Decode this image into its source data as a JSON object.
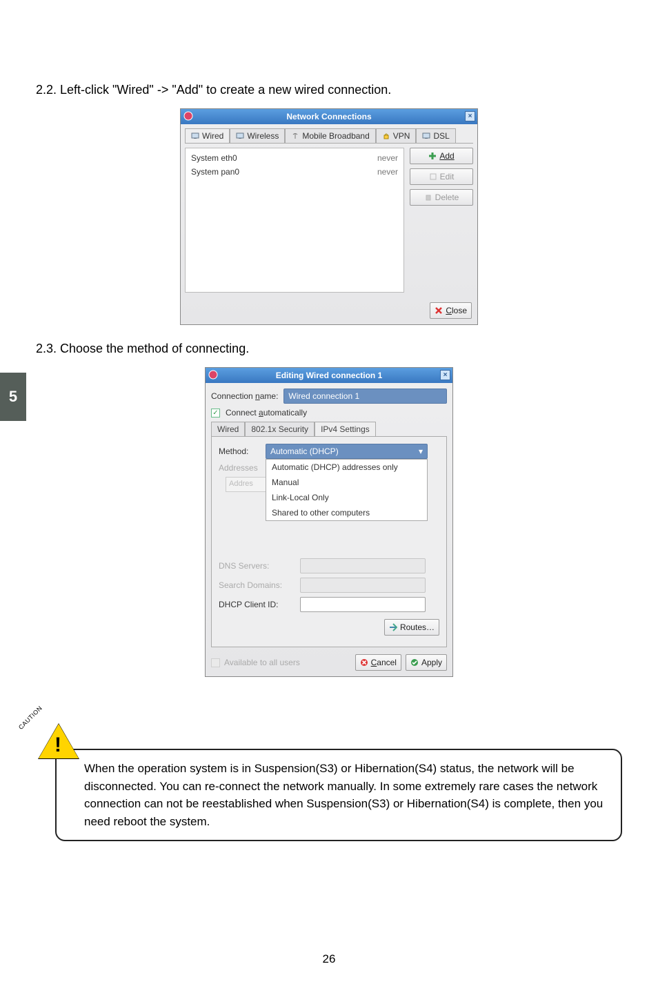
{
  "page_number": "26",
  "page_tab": "5",
  "step22": "2.2. Left-click \"Wired\" -> \"Add\" to create a new wired connection.",
  "step23": "2.3. Choose the method of connecting.",
  "dialog1": {
    "title": "Network Connections",
    "tabs": {
      "wired": "Wired",
      "wireless": "Wireless",
      "mobile": "Mobile Broadband",
      "vpn": "VPN",
      "dsl": "DSL"
    },
    "connections": [
      {
        "name": "System eth0",
        "last": "never"
      },
      {
        "name": "System pan0",
        "last": "never"
      }
    ],
    "buttons": {
      "add": "Add",
      "edit": "Edit",
      "delete": "Delete",
      "close": "Close"
    }
  },
  "dialog2": {
    "title": "Editing Wired connection 1",
    "conn_name_label": "Connection name:",
    "conn_name_value": "Wired connection 1",
    "auto_label": "Connect automatically",
    "tabs": {
      "wired": "Wired",
      "sec": "802.1x Security",
      "ipv4": "IPv4 Settings"
    },
    "method_label": "Method:",
    "method_selected": "Automatic (DHCP)",
    "method_options": [
      "Automatic (DHCP) addresses only",
      "Manual",
      "Link-Local Only",
      "Shared to other computers"
    ],
    "addresses_label": "Addresses",
    "addr_col": "Addres",
    "dns_label": "DNS Servers:",
    "search_label": "Search Domains:",
    "dhcp_label": "DHCP Client ID:",
    "routes": "Routes…",
    "avail": "Available to all users",
    "cancel": "Cancel",
    "apply": "Apply"
  },
  "caution": {
    "label": "CAUTION",
    "text": "When the operation system is in Suspension(S3) or Hibernation(S4) status, the network will be disconnected. You can re-connect the network manually. In some extremely rare cases the network connection can not be reestablished when Suspension(S3) or Hibernation(S4) is complete, then you need reboot the system."
  }
}
